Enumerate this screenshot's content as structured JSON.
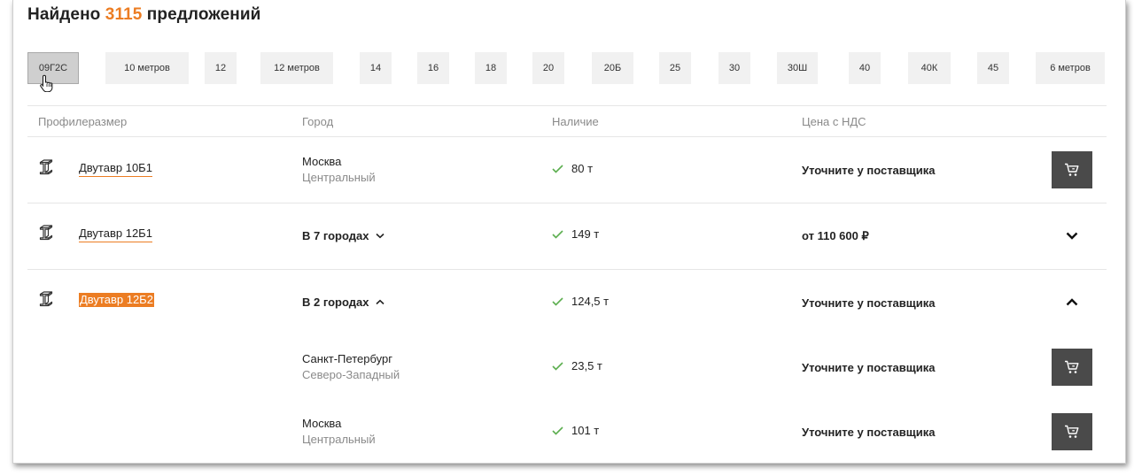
{
  "heading": {
    "prefix": "Найдено",
    "count": "3115",
    "suffix": "предложений"
  },
  "chips": [
    {
      "label": "09Г2С",
      "active": true
    },
    {
      "label": "10 метров"
    },
    {
      "label": "12"
    },
    {
      "label": "12 метров"
    },
    {
      "label": "14"
    },
    {
      "label": "16"
    },
    {
      "label": "18"
    },
    {
      "label": "20"
    },
    {
      "label": "20Б"
    },
    {
      "label": "25"
    },
    {
      "label": "30"
    },
    {
      "label": "30Ш"
    },
    {
      "label": "40"
    },
    {
      "label": "40К"
    },
    {
      "label": "45"
    },
    {
      "label": "6 метров"
    }
  ],
  "columns": {
    "profile": "Профилеразмер",
    "city": "Город",
    "stock": "Наличие",
    "price": "Цена с НДС"
  },
  "rows": [
    {
      "product": "Двутавр 10Б1",
      "city": "Москва",
      "region": "Центральный",
      "stock": "80 т",
      "price": "Уточните у поставщика",
      "action": "cart-icon"
    },
    {
      "product": "Двутавр 12Б1",
      "cities": "В 7 городах",
      "cities_state": "collapsed",
      "stock": "149 т",
      "price": "от 110 600 ₽",
      "action": "chevron-down-icon"
    },
    {
      "product": "Двутавр 12Б2",
      "cities": "В 2 городах",
      "cities_state": "expanded",
      "stock": "124,5 т",
      "price": "Уточните у поставщика",
      "action": "chevron-up-icon",
      "sub_rows": [
        {
          "city": "Санкт-Петербург",
          "region": "Северо-Западный",
          "stock": "23,5 т",
          "price": "Уточните у поставщика",
          "action": "cart-icon"
        },
        {
          "city": "Москва",
          "region": "Центральный",
          "stock": "101 т",
          "price": "Уточните у поставщика",
          "action": "cart-icon"
        }
      ]
    }
  ],
  "colors": {
    "accent": "#ec7d23",
    "cart_button": "#4a4a4a",
    "check": "#5cae4f",
    "muted": "#8a8a8a"
  }
}
